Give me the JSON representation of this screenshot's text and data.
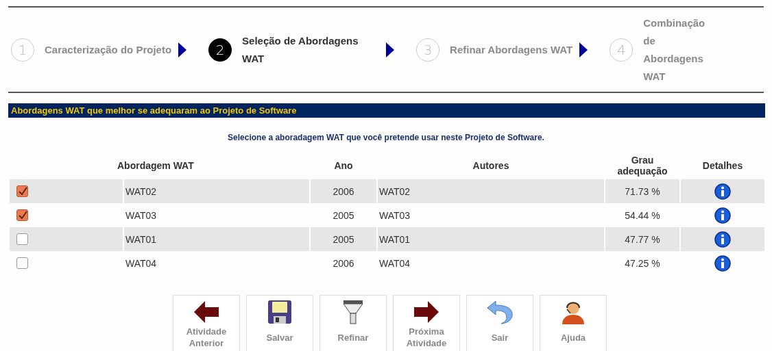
{
  "steps": [
    {
      "number": "1",
      "label": "Caracterização do Projeto",
      "selected": false
    },
    {
      "number": "2",
      "label": "Seleção de Abordagens WAT",
      "selected": true
    },
    {
      "number": "3",
      "label": "Refinar Abordagens WAT",
      "selected": false
    },
    {
      "number": "4",
      "label": "Combinação de Abordagens WAT",
      "selected": false
    }
  ],
  "section_title": "Abordagens WAT que melhor se adequaram ao Projeto de Software",
  "instruction": "Selecione a aboradagem WAT que você pretende usar neste Projeto de Software.",
  "table": {
    "columns": [
      "Abordagem WAT",
      "Ano",
      "Autores",
      "Grau adequação",
      "Detalhes"
    ],
    "rows": [
      {
        "checked": true,
        "approach": "WAT02",
        "year": "2006",
        "authors": "WAT02",
        "grade": "71.73 %"
      },
      {
        "checked": true,
        "approach": "WAT03",
        "year": "2005",
        "authors": "WAT03",
        "grade": "54.44 %"
      },
      {
        "checked": false,
        "approach": "WAT01",
        "year": "2005",
        "authors": "WAT01",
        "grade": "47.77 %"
      },
      {
        "checked": false,
        "approach": "WAT04",
        "year": "2006",
        "authors": "WAT04",
        "grade": "47.25 %"
      }
    ]
  },
  "buttons": [
    {
      "kind": "back",
      "label": "Atividade Anterior"
    },
    {
      "kind": "save",
      "label": "Salvar"
    },
    {
      "kind": "filter",
      "label": "Refinar"
    },
    {
      "kind": "next",
      "label": "Próxima Atividade"
    },
    {
      "kind": "exit",
      "label": "Sair"
    },
    {
      "kind": "help",
      "label": "Ajuda"
    }
  ]
}
